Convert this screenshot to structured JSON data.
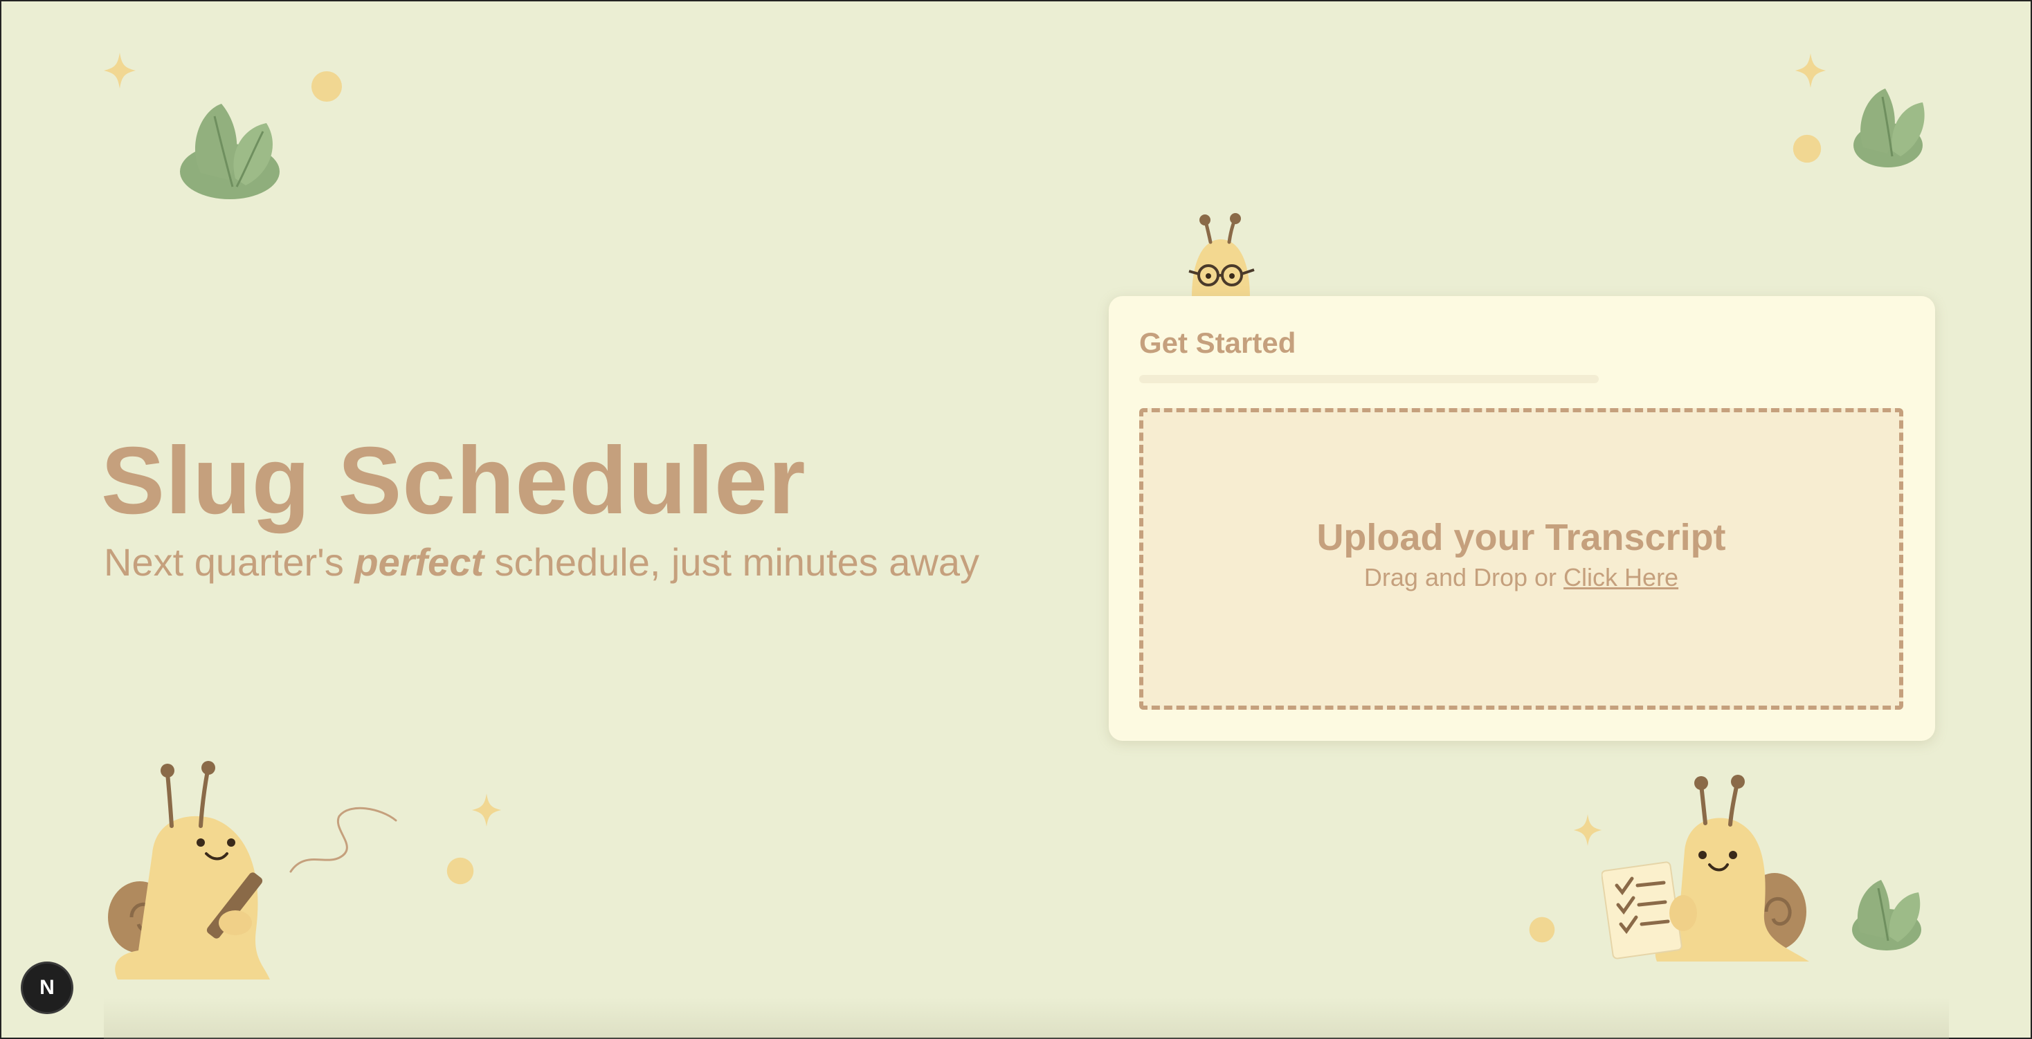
{
  "hero": {
    "title": "Slug Scheduler",
    "subtitle_before": "Next quarter's ",
    "subtitle_emphasis": "perfect",
    "subtitle_after": " schedule, just minutes away"
  },
  "card": {
    "title": "Get Started",
    "progress_percent": 0,
    "upload": {
      "title": "Upload your Transcript",
      "prompt": "Drag and Drop or ",
      "link_label": "Click Here"
    }
  },
  "dev_badge": {
    "label": "N"
  },
  "colors": {
    "background": "#EBEED3",
    "accent_brown": "#C5A07D",
    "card_bg": "#FDFAE1",
    "dropzone_bg": "#F7EDD1",
    "leaf_green": "#92B07E",
    "snail_yellow": "#F3D890"
  },
  "icons": {
    "sparkle": "four-point-star",
    "dot": "circle",
    "leaf": "leaf-cluster",
    "mascot": "snail"
  }
}
